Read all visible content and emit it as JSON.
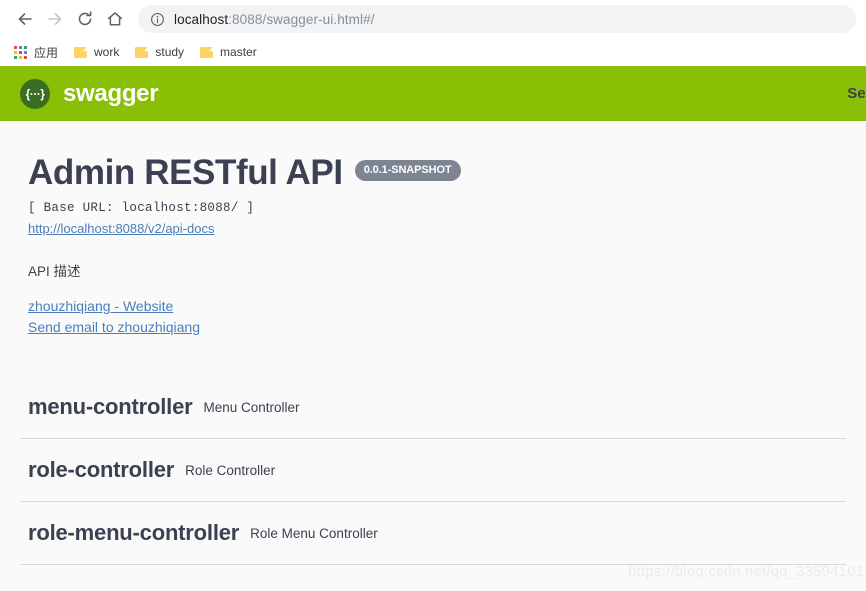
{
  "browser": {
    "nav": {
      "back_icon": "arrow-left-icon",
      "forward_icon": "arrow-right-icon",
      "reload_icon": "reload-icon",
      "home_icon": "home-icon"
    },
    "omnibox": {
      "info_icon": "info-circle-icon",
      "url_host": "localhost",
      "url_path": ":8088/swagger-ui.html#/",
      "full_url": "localhost:8088/swagger-ui.html#/"
    },
    "bookmarks": [
      {
        "label": "应用",
        "icon": "apps-grid-icon"
      },
      {
        "label": "work",
        "icon": "folder-icon"
      },
      {
        "label": "study",
        "icon": "folder-icon"
      },
      {
        "label": "master",
        "icon": "folder-icon"
      }
    ]
  },
  "swagger_header": {
    "logo_icon": "swagger-braces-icon",
    "logo_glyph": "{···}",
    "wordmark": "swagger",
    "select_spec_label": "Select a",
    "background_color": "#89bf04"
  },
  "api_info": {
    "title": "Admin RESTful API",
    "version_badge": "0.0.1-SNAPSHOT",
    "base_url": "[ Base URL: localhost:8088/ ]",
    "docs_link": "http://localhost:8088/v2/api-docs",
    "description": "API 描述",
    "contact_links": [
      {
        "label": "zhouzhiqiang - Website"
      },
      {
        "label": "Send email to zhouzhiqiang"
      }
    ],
    "link_color": "#4a7ebb",
    "badge_color": "#7d8492"
  },
  "controllers": [
    {
      "name": "menu-controller",
      "description": "Menu Controller"
    },
    {
      "name": "role-controller",
      "description": "Role Controller"
    },
    {
      "name": "role-menu-controller",
      "description": "Role Menu Controller"
    }
  ],
  "watermark": "https://blog.csdn.net/qq_33594101"
}
